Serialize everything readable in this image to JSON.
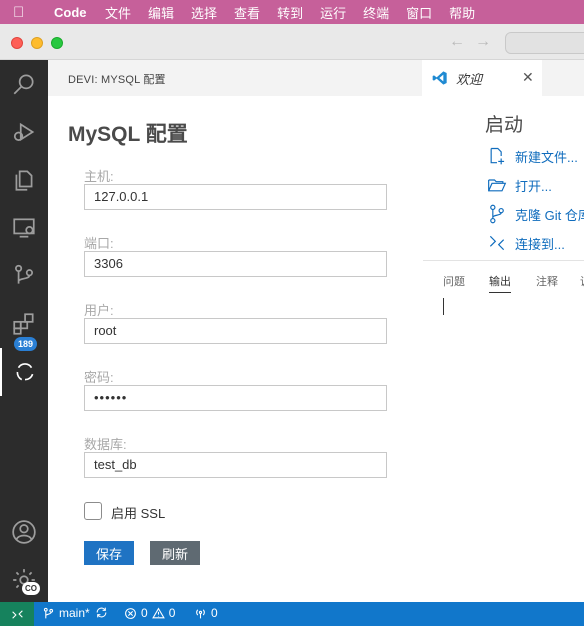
{
  "menubar": {
    "app": "Code",
    "items": [
      "文件",
      "编辑",
      "选择",
      "查看",
      "转到",
      "运行",
      "终端",
      "窗口",
      "帮助"
    ]
  },
  "activity": {
    "icons": [
      "search-icon",
      "run-debug-icon",
      "explorer-icon",
      "remote-explorer-icon",
      "source-control-icon",
      "extensions-icon",
      "database-icon",
      "account-icon",
      "settings-icon"
    ],
    "source_control_badge": "189",
    "settings_badge": "CO"
  },
  "tabs": {
    "left_title": "DEVI: MYSQL 配置",
    "welcome_label": "欢迎",
    "close": "✕"
  },
  "form": {
    "title": "MySQL 配置",
    "fields": [
      {
        "label": "主机:",
        "value": "127.0.0.1"
      },
      {
        "label": "端口:",
        "value": "3306"
      },
      {
        "label": "用户:",
        "value": "root"
      },
      {
        "label": "密码:",
        "value": "••••••"
      },
      {
        "label": "数据库:",
        "value": "test_db"
      }
    ],
    "ssl_label": "启用 SSL",
    "save_label": "保存",
    "refresh_label": "刷新"
  },
  "welcome": {
    "heading": "启动",
    "items": [
      {
        "label": "新建文件...",
        "icon": "new-file-icon"
      },
      {
        "label": "打开...",
        "icon": "open-folder-icon"
      },
      {
        "label": "克隆 Git 仓库",
        "icon": "git-clone-icon"
      },
      {
        "label": "连接到...",
        "icon": "connect-remote-icon"
      }
    ]
  },
  "panel": {
    "tabs": [
      "问题",
      "输出",
      "注释",
      "调"
    ],
    "active_tab": "输出"
  },
  "statusbar": {
    "branch": "main*",
    "errors": "0",
    "warnings": "0",
    "ports": "0"
  },
  "colors": {
    "menubar": "#c6609a",
    "activitybar": "#2c2c2c",
    "statusbar": "#1177cb",
    "remote": "#16825d",
    "save_button": "#1f73c3",
    "refresh_button": "#5f6a72",
    "link": "#0f6cbd"
  }
}
